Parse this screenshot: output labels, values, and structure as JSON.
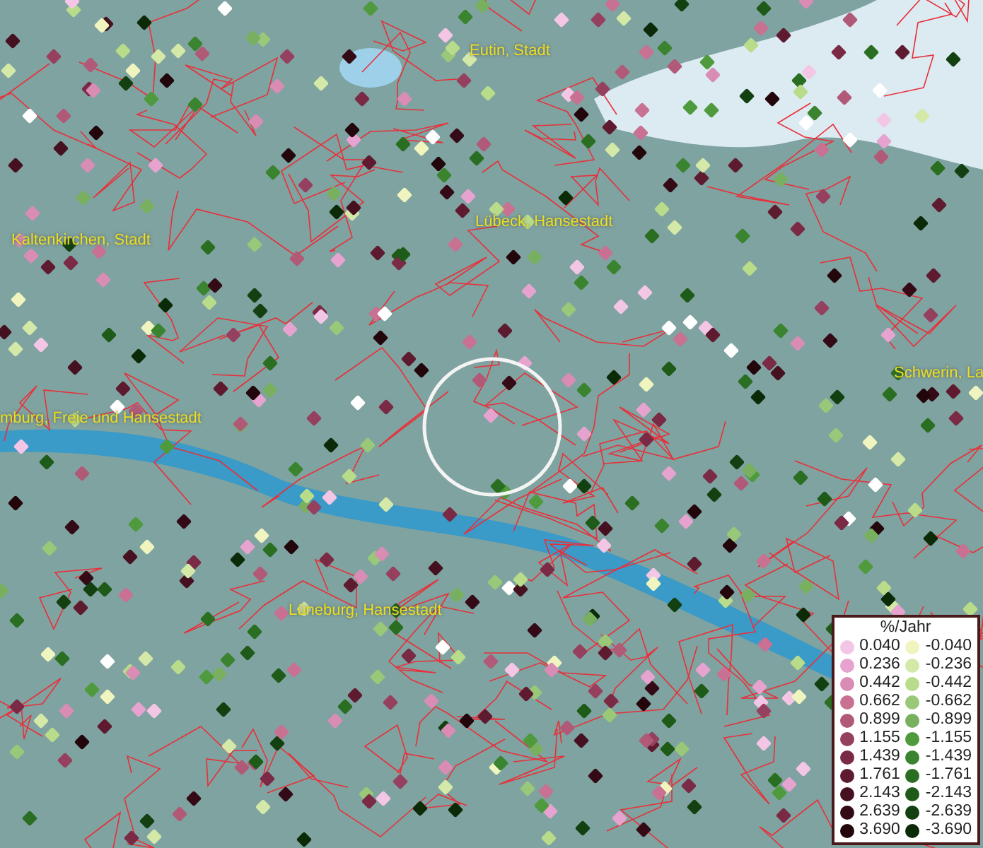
{
  "map": {
    "places": [
      {
        "name": "Eutin, Stadt"
      },
      {
        "name": "Lübeck, Hansestadt"
      },
      {
        "name": "Kaltenkirchen, Stadt"
      },
      {
        "name": "mburg, Freie und Hansestadt"
      },
      {
        "name": "Schwerin, La"
      },
      {
        "name": "Lüneburg, Hansestadt"
      }
    ],
    "legend": {
      "title": "%/Jahr",
      "positive": [
        {
          "label": "0.040",
          "color": "#f4c6e6"
        },
        {
          "label": "0.236",
          "color": "#e6a3cf"
        },
        {
          "label": "0.442",
          "color": "#d98cb4"
        },
        {
          "label": "0.662",
          "color": "#c97192"
        },
        {
          "label": "0.899",
          "color": "#b05a78"
        },
        {
          "label": "1.155",
          "color": "#964060"
        },
        {
          "label": "1.439",
          "color": "#7a2a45"
        },
        {
          "label": "1.761",
          "color": "#5e1a2e"
        },
        {
          "label": "2.143",
          "color": "#451020"
        },
        {
          "label": "2.639",
          "color": "#330a16"
        },
        {
          "label": "3.690",
          "color": "#22060c"
        }
      ],
      "negative": [
        {
          "label": "-0.040",
          "color": "#f0f5c0"
        },
        {
          "label": "-0.236",
          "color": "#d4e8a8"
        },
        {
          "label": "-0.442",
          "color": "#b8dc8a"
        },
        {
          "label": "-0.662",
          "color": "#98c878"
        },
        {
          "label": "-0.899",
          "color": "#78b060"
        },
        {
          "label": "-1.155",
          "color": "#4e9a3c"
        },
        {
          "label": "-1.439",
          "color": "#3a8430"
        },
        {
          "label": "-1.761",
          "color": "#2a6e22"
        },
        {
          "label": "-2.143",
          "color": "#1e5a18"
        },
        {
          "label": "-2.639",
          "color": "#134010"
        },
        {
          "label": "-3.690",
          "color": "#0a2a08"
        }
      ]
    }
  }
}
